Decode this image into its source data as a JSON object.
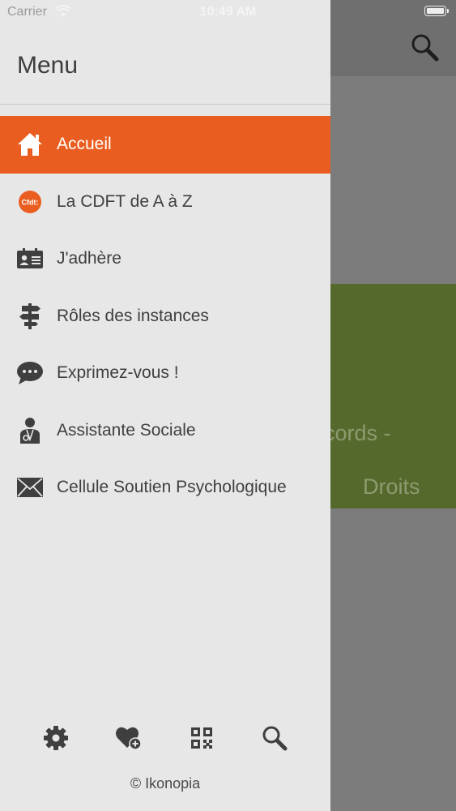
{
  "status_bar": {
    "carrier": "Carrier",
    "time": "10:49 AM"
  },
  "background": {
    "tile_text_line1": "cords -",
    "tile_text_line2": "Droits"
  },
  "drawer": {
    "title": "Menu",
    "items": [
      {
        "label": "Accueil",
        "icon": "home-icon",
        "active": true
      },
      {
        "label": "La CDFT de A à Z",
        "icon": "cfdt-logo-icon",
        "active": false
      },
      {
        "label": "J'adhère",
        "icon": "member-card-icon",
        "active": false
      },
      {
        "label": "Rôles des instances",
        "icon": "signpost-icon",
        "active": false
      },
      {
        "label": "Exprimez-vous !",
        "icon": "speech-bubble-icon",
        "active": false
      },
      {
        "label": "Assistante Sociale",
        "icon": "person-icon",
        "active": false
      },
      {
        "label": "Cellule Soutien Psychologique",
        "icon": "envelope-icon",
        "active": false
      }
    ],
    "footer_icons": [
      "settings-icon",
      "favorite-add-icon",
      "qr-code-icon",
      "search-icon"
    ],
    "copyright": "© Ikonopia"
  },
  "colors": {
    "accent": "#e95e20",
    "drawer_bg": "#e8e7e8",
    "text": "#3f3f3f",
    "tile_green": "#56692d"
  }
}
